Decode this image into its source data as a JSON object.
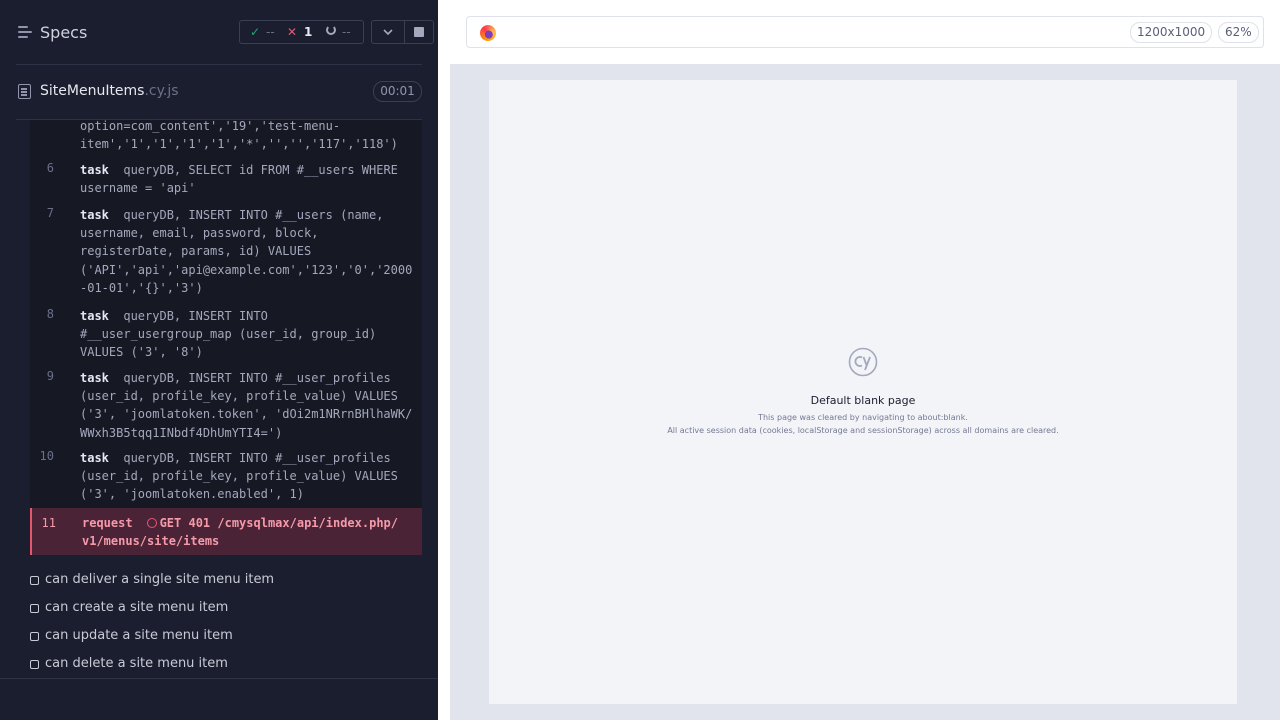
{
  "reporter": {
    "title": "Specs",
    "stats": {
      "passed": "--",
      "failed": "1",
      "pending": "--"
    },
    "spec": {
      "name": "SiteMenuItems",
      "ext": ".cy.js",
      "duration": "00:01"
    },
    "commands": [
      {
        "number": "",
        "name": "",
        "lines": [
          "option=com_content','19','test-menu-",
          "item','1','1','1','1','*','','','117','118')"
        ]
      },
      {
        "number": "6",
        "name": "task",
        "lines": [
          "queryDB, SELECT id FROM #__users WHERE",
          "username = 'api'"
        ]
      },
      {
        "number": "7",
        "name": "task",
        "lines": [
          "queryDB, INSERT INTO #__users (name,",
          "username, email, password, block,",
          "registerDate, params, id) VALUES",
          "('API','api','api@example.com','123','0','2000",
          "-01-01','{}','3')"
        ]
      },
      {
        "number": "8",
        "name": "task",
        "lines": [
          "queryDB, INSERT INTO",
          "#__user_usergroup_map (user_id, group_id)",
          "VALUES ('3', '8')"
        ]
      },
      {
        "number": "9",
        "name": "task",
        "lines": [
          "queryDB, INSERT INTO #__user_profiles",
          "(user_id, profile_key, profile_value) VALUES",
          "('3', 'joomlatoken.token', 'dOi2m1NRrnBHlhaWK/",
          "WWxh3B5tqq1INbdf4DhUmYTI4=')"
        ]
      },
      {
        "number": "10",
        "name": "task",
        "lines": [
          "queryDB, INSERT INTO #__user_profiles",
          "(user_id, profile_key, profile_value) VALUES",
          "('3', 'joomlatoken.enabled', 1)"
        ]
      }
    ],
    "error_command": {
      "number": "11",
      "name": "request",
      "lines": [
        "GET 401 /cmysqlmax/api/index.php/",
        "v1/menus/site/items"
      ]
    },
    "tests": [
      "can deliver a single site menu item",
      "can create a site menu item",
      "can update a site menu item",
      "can delete a site menu item"
    ]
  },
  "aut": {
    "viewport": "1200x1000",
    "zoom": "62%",
    "blank_page": {
      "title": "Default blank page",
      "line1": "This page was cleared by navigating to about:blank.",
      "line2": "All active session data (cookies, localStorage and sessionStorage) across all domains are cleared."
    }
  },
  "icons": {
    "specs": "menu-lines-icon",
    "passed": "check-icon",
    "failed": "x-icon",
    "pending": "spinner-icon",
    "controls": "chevron-down-icon",
    "stop": "stop-icon",
    "spec_file": "document-icon",
    "browser": "firefox-icon",
    "logo": "cypress-logo"
  },
  "colors": {
    "passed": "#1fa971",
    "failed": "#e45770",
    "background": "#1b1e2e",
    "error_bg": "#4a2337"
  }
}
